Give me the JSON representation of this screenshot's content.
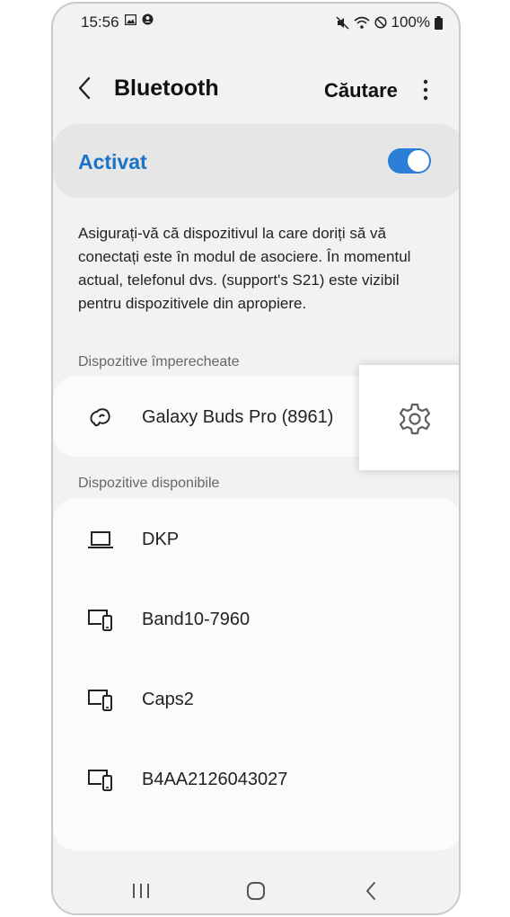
{
  "status_bar": {
    "time": "15:56",
    "battery": "100%"
  },
  "header": {
    "title": "Bluetooth",
    "search_label": "Căutare"
  },
  "toggle": {
    "label": "Activat",
    "on": true
  },
  "description": "Asigurați-vă că dispozitivul la care doriți să vă conectați este în modul de asociere. În momentul actual, telefonul dvs. (support's S21) este vizibil pentru dispozitivele din apropiere.",
  "paired": {
    "section_title": "Dispozitive împerecheate",
    "devices": [
      {
        "name": "Galaxy Buds Pro (8961)",
        "icon": "earbuds-icon"
      }
    ]
  },
  "available": {
    "section_title": "Dispozitive disponibile",
    "devices": [
      {
        "name": "DKP",
        "icon": "laptop-icon"
      },
      {
        "name": "Band10-7960",
        "icon": "multi-device-icon"
      },
      {
        "name": "Caps2",
        "icon": "multi-device-icon"
      },
      {
        "name": "B4AA2126043027",
        "icon": "multi-device-icon"
      }
    ]
  },
  "colors": {
    "accent": "#1a73c7",
    "switch_on": "#2b7fd8",
    "background": "#f2f2f2"
  }
}
